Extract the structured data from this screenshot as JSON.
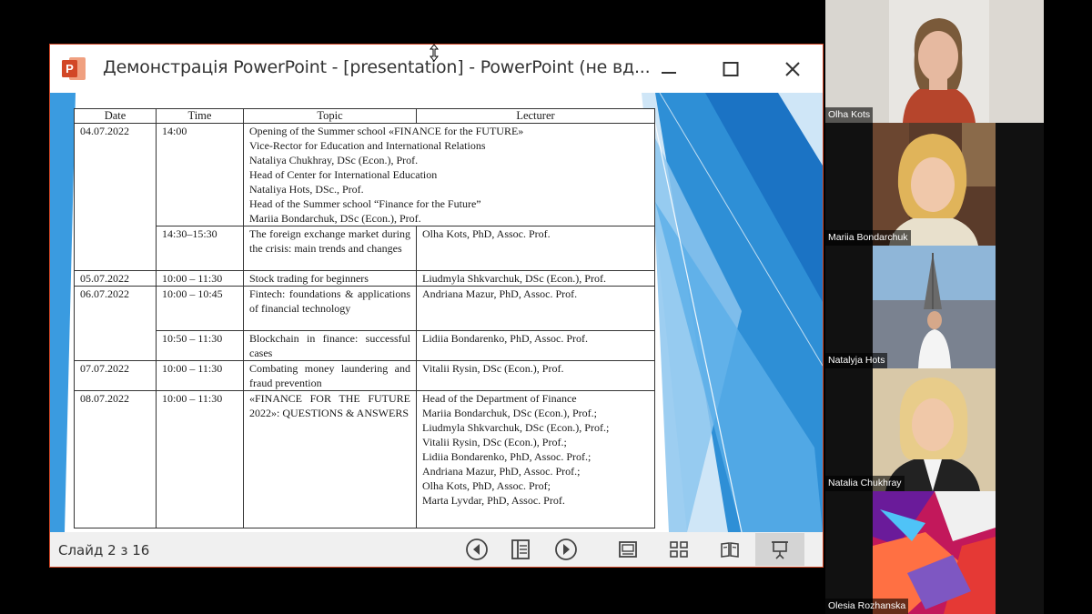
{
  "window": {
    "title": "Демонстрація PowerPoint - [presentation] - PowerPoint (не вд..."
  },
  "slide": {
    "headers": [
      "Date",
      "Time",
      "Topic",
      "Lecturer"
    ],
    "row1": {
      "date": "04.07.2022",
      "time": "14:00",
      "topic_lines": [
        "Opening of the Summer school «FINANCE for the FUTURE»",
        "Vice-Rector for Education and International Relations",
        "Nataliya Chukhray, DSc (Econ.), Prof.",
        "Head of Center for International Education",
        "Nataliya Hots, DSc., Prof.",
        "Head of the Summer school “Finance for the Future”",
        "Mariia Bondarchuk, DSc (Econ.), Prof."
      ]
    },
    "row2": {
      "time": "14:30–15:30",
      "topic": "The foreign exchange market during the crisis: main trends and changes",
      "lecturer": "Olha Kots, PhD, Assoc. Prof."
    },
    "row3": {
      "date": "05.07.2022",
      "time": "10:00 – 11:30",
      "topic": "Stock trading for beginners",
      "lecturer": "Liudmyla Shkvarchuk, DSc (Econ.), Prof."
    },
    "row4": {
      "date": "06.07.2022",
      "time": "10:00 – 10:45",
      "topic": "Fintech: foundations & applications of financial technology",
      "lecturer": "Andriana Mazur, PhD, Assoc. Prof."
    },
    "row5": {
      "time": "10:50 – 11:30",
      "topic": "Blockchain in finance: successful cases",
      "lecturer": "Lidiia Bondarenko, PhD, Assoc. Prof."
    },
    "row6": {
      "date": "07.07.2022",
      "time": "10:00 – 11:30",
      "topic": "Combating money laundering and fraud prevention",
      "lecturer": "Vitalii Rysin, DSc (Econ.), Prof."
    },
    "row7": {
      "date": "08.07.2022",
      "time": "10:00 – 11:30",
      "topic": "«FINANCE FOR THE FUTURE 2022»: QUESTIONS & ANSWERS",
      "lecturer_lines": [
        "Head of the Department of  Finance",
        "Mariia Bondarchuk, DSc (Econ.), Prof.;",
        "Liudmyla Shkvarchuk, DSc (Econ.), Prof.;",
        "Vitalii Rysin, DSc (Econ.), Prof.;",
        "Lidiia Bondarenko, PhD, Assoc. Prof.;",
        "Andriana Mazur, PhD, Assoc. Prof.;",
        "Olha Kots,  PhD, Assoc. Prof;",
        "Marta Lyvdar, PhD, Assoc. Prof."
      ]
    }
  },
  "statusbar": {
    "slide_counter": "Слайд 2 з 16"
  },
  "participants": [
    {
      "name": "Olha Kots"
    },
    {
      "name": "Mariia Bondarchuk"
    },
    {
      "name": "Natalyja Hots"
    },
    {
      "name": "Natalia Chukhray"
    },
    {
      "name": "Olesia Rozhanska"
    }
  ],
  "colors": {
    "ppt_accent": "#d24726",
    "slide_blue": "#2e8fd6"
  }
}
